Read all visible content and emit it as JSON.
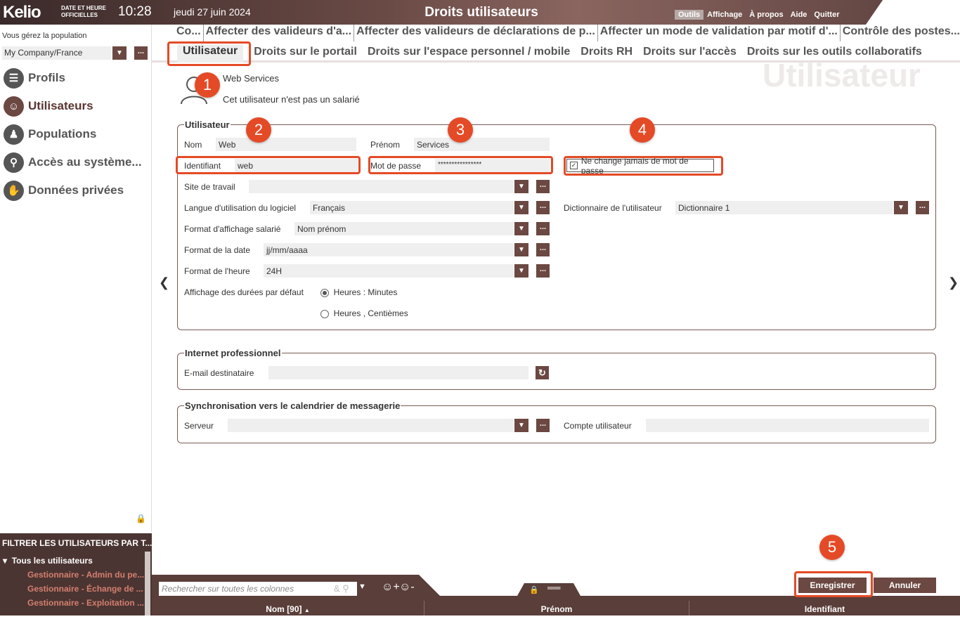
{
  "header": {
    "logo": "Kelio",
    "official_label": "DATE ET HEURE OFFICIELLES",
    "clock": "10:28",
    "date": "jeudi 27 juin 2024",
    "title": "Droits utilisateurs",
    "menu": [
      "Outils",
      "Affichage",
      "À propos",
      "Aide",
      "Quitter"
    ]
  },
  "sidebar": {
    "population_label": "Vous gérez la population",
    "company": "My Company/France",
    "items": [
      {
        "label": "Profils"
      },
      {
        "label": "Utilisateurs"
      },
      {
        "label": "Populations"
      },
      {
        "label": "Accès au système..."
      },
      {
        "label": "Données privées"
      }
    ]
  },
  "filter": {
    "title": "FILTRER LES UTILISATEURS PAR T...",
    "all": "Tous les utilisateurs",
    "children": [
      "Gestionnaire - Admin du pe...",
      "Gestionnaire - Échange de ...",
      "Gestionnaire - Exploitation ..."
    ]
  },
  "tabs_top": [
    "Co...",
    "Affecter des valideurs d'a...",
    "Affecter des valideurs de déclarations de p...",
    "Affecter un mode de validation par motif d'...",
    "Contrôle des postes..."
  ],
  "tabs": [
    "Utilisateur",
    "Droits sur le portail",
    "Droits sur l'espace personnel / mobile",
    "Droits RH",
    "Droits sur l'accès",
    "Droits sur les outils collaboratifs"
  ],
  "watermark": "Utilisateur",
  "user_header": {
    "name": "Web Services",
    "status": "Cet utilisateur n'est pas un salarié"
  },
  "section_user": {
    "legend": "Utilisateur",
    "nom_label": "Nom",
    "nom": "Web",
    "prenom_label": "Prénom",
    "prenom": "Services",
    "id_label": "Identifiant",
    "id": "web",
    "pwd_label": "Mot de passe",
    "pwd": "****************",
    "never_change": "Ne change jamais de mot de passe",
    "site_label": "Site de travail",
    "site": "",
    "langue_label": "Langue d'utilisation du logiciel",
    "langue": "Français",
    "dict_label": "Dictionnaire de l'utilisateur",
    "dict": "Dictionnaire 1",
    "format_sal_label": "Format d'affichage salarié",
    "format_sal": "Nom prénom",
    "date_label": "Format de la date",
    "date": "jj/mm/aaaa",
    "heure_label": "Format de l'heure",
    "heure": "24H",
    "durees_label": "Affichage des durées par défaut",
    "opt1": "Heures : Minutes",
    "opt2": "Heures , Centièmes"
  },
  "section_internet": {
    "legend": "Internet professionnel",
    "email_label": "E-mail destinataire",
    "email": ""
  },
  "section_sync": {
    "legend": "Synchronisation vers le calendrier de messagerie",
    "serveur_label": "Serveur",
    "serveur": "",
    "compte_label": "Compte utilisateur",
    "compte": ""
  },
  "steps": [
    "1",
    "2",
    "3",
    "4",
    "5"
  ],
  "bottom": {
    "search_placeholder": "Rechercher sur toutes les colonnes",
    "save": "Enregistrer",
    "cancel": "Annuler",
    "col1": "Nom [90]",
    "col2": "Prénom",
    "col3": "Identifiant"
  },
  "colors": {
    "brand": "#6b4841",
    "highlight": "#e54a26"
  }
}
